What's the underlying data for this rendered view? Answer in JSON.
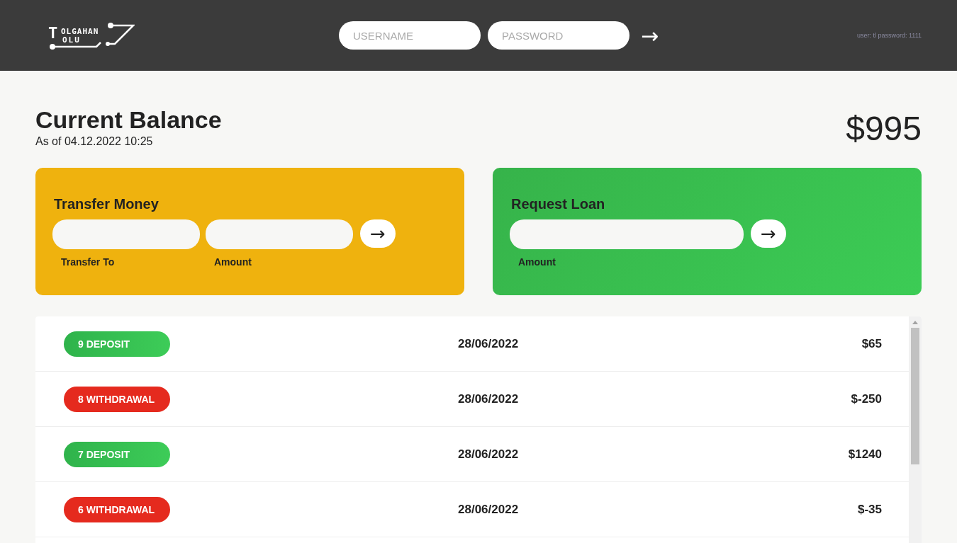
{
  "header": {
    "logo": {
      "initial": "T",
      "line1": "OLGAHAN",
      "line2": "OLU"
    },
    "username": {
      "placeholder": "USERNAME"
    },
    "password": {
      "placeholder": "PASSWORD"
    },
    "login_arrow": "→",
    "hint": "user: tl password: 1111"
  },
  "balance": {
    "title": "Current Balance",
    "date_label": "As of",
    "date": "04.12.2022 10:25",
    "amount": "$995"
  },
  "operations": [
    {
      "kind": "transfer",
      "title": "Transfer Money",
      "fields": [
        "Transfer To",
        "Amount"
      ],
      "arrow": "→"
    },
    {
      "kind": "loan",
      "title": "Request Loan",
      "fields": [
        "Amount"
      ],
      "arrow": "→"
    }
  ],
  "movements": [
    {
      "kind": "deposit",
      "label": "9 DEPOSIT",
      "date": "28/06/2022",
      "value": "$65"
    },
    {
      "kind": "withdrawal",
      "label": "8 WITHDRAWAL",
      "date": "28/06/2022",
      "value": "$-250"
    },
    {
      "kind": "deposit",
      "label": "7 DEPOSIT",
      "date": "28/06/2022",
      "value": "$1240"
    },
    {
      "kind": "withdrawal",
      "label": "6 WITHDRAWAL",
      "date": "28/06/2022",
      "value": "$-35"
    }
  ]
}
